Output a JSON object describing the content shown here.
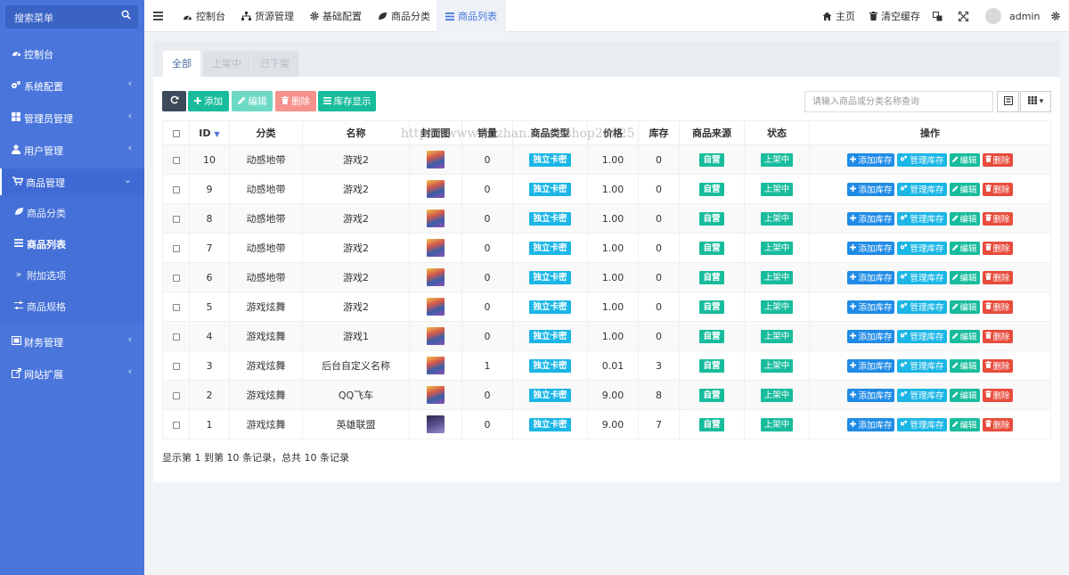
{
  "sidebar": {
    "search_placeholder": "搜索菜单",
    "items": [
      {
        "label": "控制台",
        "icon": "dashboard-icon"
      },
      {
        "label": "系统配置",
        "icon": "cogs-icon"
      },
      {
        "label": "管理员管理",
        "icon": "windows-icon"
      },
      {
        "label": "用户管理",
        "icon": "user-icon"
      },
      {
        "label": "商品管理",
        "icon": "cart-icon"
      },
      {
        "label": "财务管理",
        "icon": "money-icon"
      },
      {
        "label": "网站扩展",
        "icon": "external-link-icon"
      }
    ],
    "submenu": [
      {
        "label": "商品分类",
        "icon": "leaf-icon"
      },
      {
        "label": "商品列表",
        "icon": "list-icon"
      },
      {
        "label": "附加选项",
        "icon": "double-angle-right-icon"
      },
      {
        "label": "商品规格",
        "icon": "sliders-icon"
      }
    ]
  },
  "topbar": {
    "tabs": [
      {
        "label": "控制台",
        "icon": "dashboard-icon"
      },
      {
        "label": "货源管理",
        "icon": "sitemap-icon"
      },
      {
        "label": "基础配置",
        "icon": "cog-icon"
      },
      {
        "label": "商品分类",
        "icon": "leaf-icon"
      },
      {
        "label": "商品列表",
        "icon": "list-icon"
      }
    ],
    "home_label": "主页",
    "clear_cache_label": "清空缓存",
    "username": "admin"
  },
  "filter_tabs": [
    "全部",
    "上架中",
    "已下架"
  ],
  "toolbar": {
    "add_label": "添加",
    "edit_label": "编辑",
    "delete_label": "删除",
    "stock_label": "库存显示",
    "search_placeholder": "请输入商品或分类名称查询"
  },
  "table": {
    "columns": [
      "ID",
      "分类",
      "名称",
      "封面图",
      "销量",
      "商品类型",
      "价格",
      "库存",
      "商品来源",
      "状态",
      "操作"
    ],
    "rows": [
      {
        "id": "10",
        "category": "动感地带",
        "name": "游戏2",
        "sales": "0",
        "type": "独立卡密",
        "price": "1.00",
        "stock": "0",
        "source": "自营",
        "status": "上架中",
        "thumb": 0
      },
      {
        "id": "9",
        "category": "动感地带",
        "name": "游戏2",
        "sales": "0",
        "type": "独立卡密",
        "price": "1.00",
        "stock": "0",
        "source": "自营",
        "status": "上架中",
        "thumb": 0
      },
      {
        "id": "8",
        "category": "动感地带",
        "name": "游戏2",
        "sales": "0",
        "type": "独立卡密",
        "price": "1.00",
        "stock": "0",
        "source": "自营",
        "status": "上架中",
        "thumb": 0
      },
      {
        "id": "7",
        "category": "动感地带",
        "name": "游戏2",
        "sales": "0",
        "type": "独立卡密",
        "price": "1.00",
        "stock": "0",
        "source": "自营",
        "status": "上架中",
        "thumb": 0
      },
      {
        "id": "6",
        "category": "动感地带",
        "name": "游戏2",
        "sales": "0",
        "type": "独立卡密",
        "price": "1.00",
        "stock": "0",
        "source": "自营",
        "status": "上架中",
        "thumb": 0
      },
      {
        "id": "5",
        "category": "游戏炫舞",
        "name": "游戏2",
        "sales": "0",
        "type": "独立卡密",
        "price": "1.00",
        "stock": "0",
        "source": "自营",
        "status": "上架中",
        "thumb": 0
      },
      {
        "id": "4",
        "category": "游戏炫舞",
        "name": "游戏1",
        "sales": "0",
        "type": "独立卡密",
        "price": "1.00",
        "stock": "0",
        "source": "自营",
        "status": "上架中",
        "thumb": 0
      },
      {
        "id": "3",
        "category": "游戏炫舞",
        "name": "后台自定义名称",
        "sales": "1",
        "type": "独立卡密",
        "price": "0.01",
        "stock": "3",
        "source": "自营",
        "status": "上架中",
        "thumb": 0
      },
      {
        "id": "2",
        "category": "游戏炫舞",
        "name": "QQ飞车",
        "sales": "0",
        "type": "独立卡密",
        "price": "9.00",
        "stock": "8",
        "source": "自营",
        "status": "上架中",
        "thumb": 0
      },
      {
        "id": "1",
        "category": "游戏炫舞",
        "name": "英雄联盟",
        "sales": "0",
        "type": "独立卡密",
        "price": "9.00",
        "stock": "7",
        "source": "自营",
        "status": "上架中",
        "thumb": 1
      }
    ],
    "row_actions": [
      "添加库存",
      "管理库存",
      "编辑",
      "删除"
    ]
  },
  "pagination_text": "显示第 1 到第 10 条记录，总共 10 条记录",
  "watermark": "https://www.huzhan.com/ishop20325",
  "colors": {
    "sidebar": "#4a76dc",
    "primary": "#18bc9c",
    "info": "#1bb6e6",
    "danger": "#e74c3c",
    "blue": "#1f8be6"
  }
}
